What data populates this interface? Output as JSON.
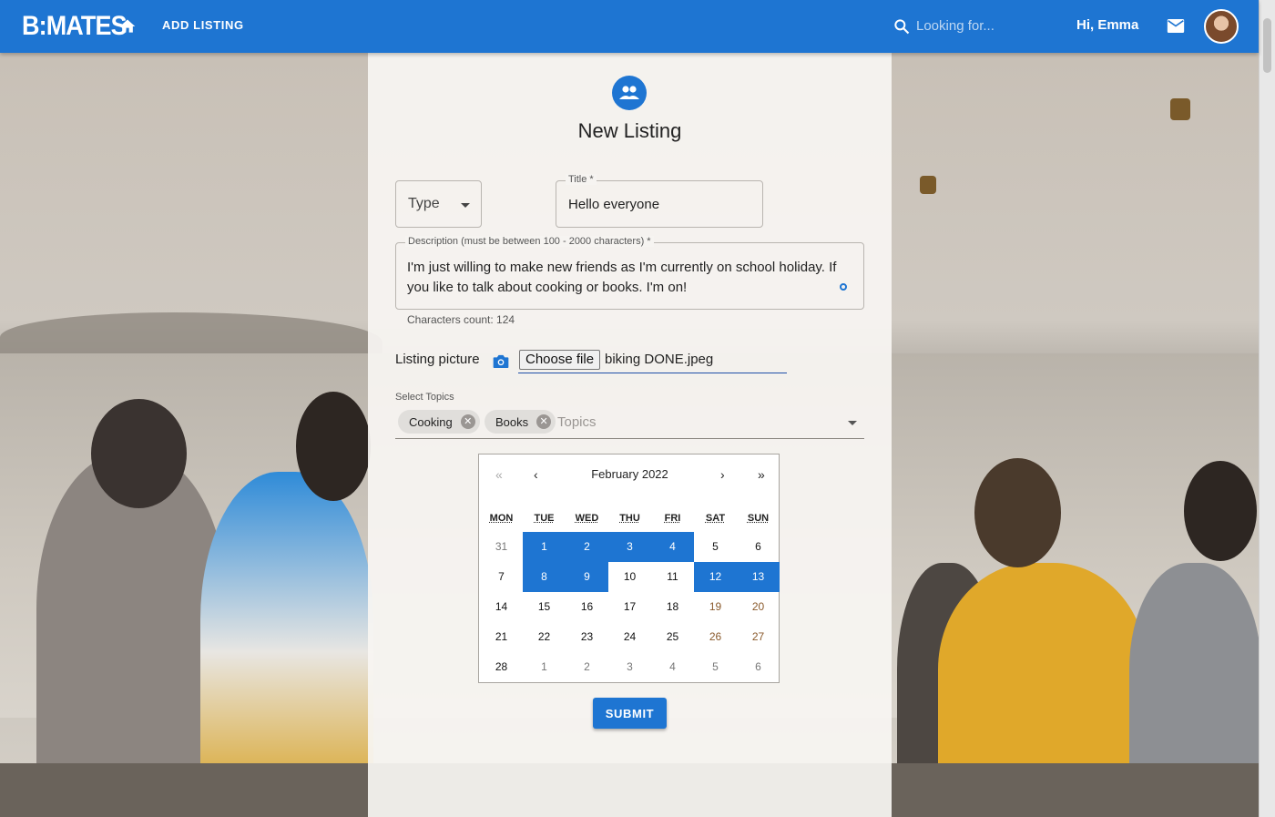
{
  "header": {
    "logo": "B:MATES",
    "nav_add_listing": "ADD LISTING",
    "search_placeholder": "Looking for...",
    "greeting": "Hi, Emma",
    "brand_color": "#1e75d2"
  },
  "form": {
    "heading": "New Listing",
    "type_label": "Type",
    "title_label": "Title *",
    "title_value": "Hello everyone",
    "description_label": "Description (must be between 100 - 2000 characters) *",
    "description_value": "I'm just willing to make new friends as I'm currently on school holiday. If you like to talk about cooking or books. I'm on!",
    "characters_count": "Characters count: 124",
    "picture_label": "Listing picture",
    "choose_file": "Choose file",
    "file_name": "biking DONE.jpeg",
    "topics_label": "Select Topics",
    "topics": [
      "Cooking",
      "Books"
    ],
    "topics_placeholder": "Topics",
    "submit": "SUBMIT"
  },
  "calendar": {
    "month": "February 2022",
    "nav": {
      "first": "«",
      "prev": "‹",
      "next": "›",
      "last": "»"
    },
    "weekdays": [
      "MON",
      "TUE",
      "WED",
      "THU",
      "FRI",
      "SAT",
      "SUN"
    ],
    "weeks": [
      [
        "31",
        "1",
        "2",
        "3",
        "4",
        "5",
        "6"
      ],
      [
        "7",
        "8",
        "9",
        "10",
        "11",
        "12",
        "13"
      ],
      [
        "14",
        "15",
        "16",
        "17",
        "18",
        "19",
        "20"
      ],
      [
        "21",
        "22",
        "23",
        "24",
        "25",
        "26",
        "27"
      ],
      [
        "28",
        "1",
        "2",
        "3",
        "4",
        "5",
        "6"
      ]
    ],
    "selected": [
      "1",
      "2",
      "3",
      "4",
      "8",
      "9",
      "12",
      "13"
    ]
  },
  "icons": {
    "home": "home-icon",
    "search": "search-icon",
    "mail": "mail-icon",
    "group": "group-icon",
    "camera": "camera-icon"
  }
}
